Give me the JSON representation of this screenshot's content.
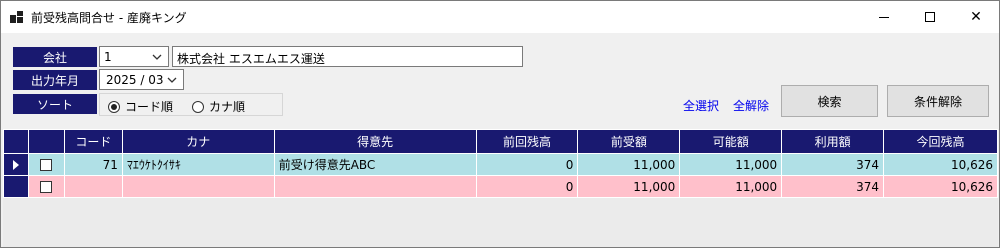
{
  "window": {
    "title": "前受残高問合せ - 産廃キング",
    "minimize_label": "",
    "maximize_label": "",
    "close_label": "✕"
  },
  "form": {
    "company_label": "会社",
    "company_code": "1",
    "company_name": "株式会社 エスエムエス運送",
    "period_label": "出力年月",
    "period_value": "2025 /  03",
    "sort_label": "ソート",
    "sort_options": [
      "コード順",
      "カナ順"
    ],
    "sort_selected": "コード順"
  },
  "actions": {
    "select_all": "全選択",
    "deselect_all": "全解除",
    "search": "検索",
    "clear": "条件解除"
  },
  "grid": {
    "columns": [
      "",
      "コード",
      "カナ",
      "得意先",
      "前回残高",
      "前受額",
      "可能額",
      "利用額",
      "今回残高"
    ],
    "rows": [
      {
        "checked": false,
        "code": "71",
        "kana": "ﾏｴｳｹﾄｸｲｻｷ",
        "customer": "前受け得意先ABC",
        "prev_balance": "0",
        "advance": "11,000",
        "available": "11,000",
        "used": "374",
        "current_balance": "10,626"
      },
      {
        "checked": false,
        "code": "",
        "kana": "",
        "customer": "",
        "prev_balance": "0",
        "advance": "11,000",
        "available": "11,000",
        "used": "374",
        "current_balance": "10,626"
      }
    ]
  }
}
